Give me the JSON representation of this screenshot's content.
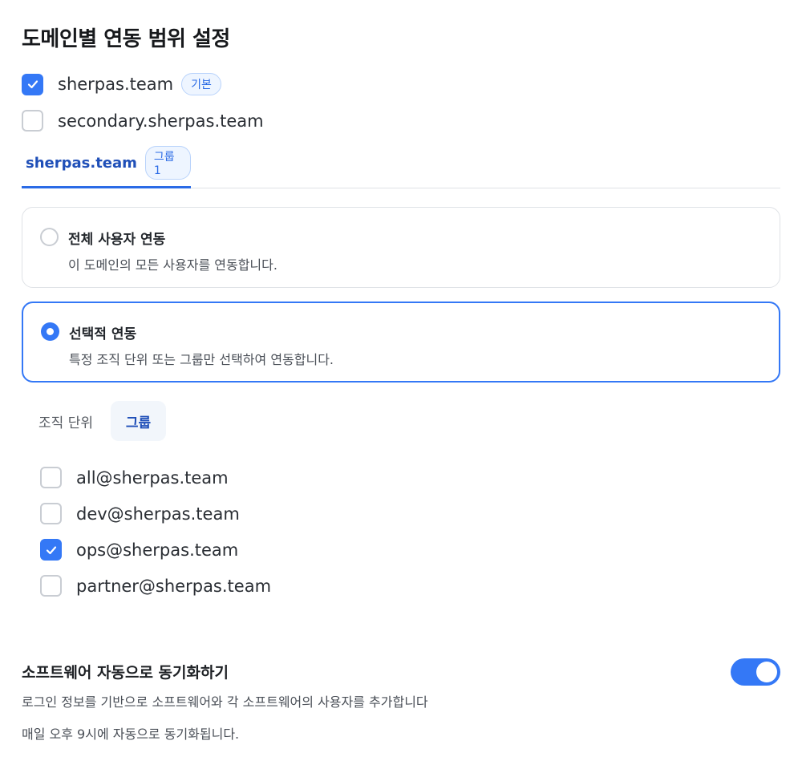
{
  "page": {
    "title": "도메인별 연동 범위 설정"
  },
  "domains": [
    {
      "name": "sherpas.team",
      "checked": true,
      "badge": "기본"
    },
    {
      "name": "secondary.sherpas.team",
      "checked": false
    }
  ],
  "domain_tab": {
    "label": "sherpas.team",
    "badge": "그룹 1"
  },
  "options": [
    {
      "title": "전체 사용자 연동",
      "description": "이 도메인의 모든 사용자를 연동합니다.",
      "selected": false
    },
    {
      "title": "선택적 연동",
      "description": "특정 조직 단위 또는 그룹만 선택하여 연동합니다.",
      "selected": true
    }
  ],
  "subtabs": [
    {
      "label": "조직 단위",
      "active": false
    },
    {
      "label": "그룹",
      "active": true
    }
  ],
  "groups": [
    {
      "email": "all@sherpas.team",
      "checked": false
    },
    {
      "email": "dev@sherpas.team",
      "checked": false
    },
    {
      "email": "ops@sherpas.team",
      "checked": true
    },
    {
      "email": "partner@sherpas.team",
      "checked": false
    }
  ],
  "sync": {
    "title": "소프트웨어 자동으로 동기화하기",
    "description": "로그인 정보를 기반으로 소프트웨어와 각 소프트웨어의 사용자를 추가합니다",
    "note": "매일 오후 9시에 자동으로 동기화됩니다.",
    "enabled": true
  },
  "colors": {
    "accent": "#3478f6",
    "accent_text": "#1f4fb8"
  }
}
